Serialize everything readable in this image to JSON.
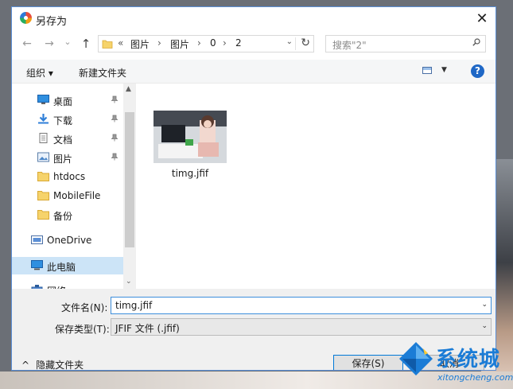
{
  "window": {
    "title": "另存为",
    "close_glyph": "✕"
  },
  "nav": {
    "back_glyph": "←",
    "forward_glyph": "→",
    "recent_glyph": "⌄",
    "up_glyph": "↑",
    "address": [
      "«",
      "图片",
      "›",
      "图片",
      "›",
      "0",
      "›",
      "2"
    ],
    "dropdown_glyph": "⌄",
    "refresh_glyph": "↻",
    "search_placeholder": "搜索\"2\""
  },
  "toolbar": {
    "organize_label": "组织 ▾",
    "new_folder_label": "新建文件夹",
    "help_label": "?",
    "view_drop": "▼"
  },
  "sidebar": {
    "items": [
      {
        "label": "桌面",
        "icon": "desktop-icon",
        "pinned": true
      },
      {
        "label": "下载",
        "icon": "download-icon",
        "pinned": true
      },
      {
        "label": "文档",
        "icon": "document-icon",
        "pinned": true
      },
      {
        "label": "图片",
        "icon": "pictures-icon",
        "pinned": true
      },
      {
        "label": "htdocs",
        "icon": "folder-icon",
        "pinned": false
      },
      {
        "label": "MobileFile",
        "icon": "folder-icon",
        "pinned": false
      },
      {
        "label": "备份",
        "icon": "folder-icon",
        "pinned": false
      },
      {
        "label": "OneDrive",
        "icon": "onedrive-icon",
        "pinned": false
      },
      {
        "label": "此电脑",
        "icon": "computer-icon",
        "pinned": false,
        "selected": true
      },
      {
        "label": "网络",
        "icon": "network-icon",
        "pinned": false
      }
    ],
    "scroll_up": "▲",
    "scroll_down": "⌄"
  },
  "files": [
    {
      "name": "timg.jfif"
    }
  ],
  "form": {
    "filename_label": "文件名(N):",
    "filename_value": "timg.jfif",
    "filetype_label": "保存类型(T):",
    "filetype_value": "JFIF 文件 (.jfif)",
    "arrow_glyph": "⌄"
  },
  "footer": {
    "hide_folders_label": "隐藏文件夹",
    "hide_glyph": "^",
    "save_label": "保存(S)",
    "cancel_label": "取消"
  },
  "watermark": {
    "text": "系统城",
    "url": "xitongcheng.com"
  },
  "colors": {
    "accent": "#1e67c6",
    "selection": "#cce4f7",
    "watermark": "#1b7cd6"
  }
}
